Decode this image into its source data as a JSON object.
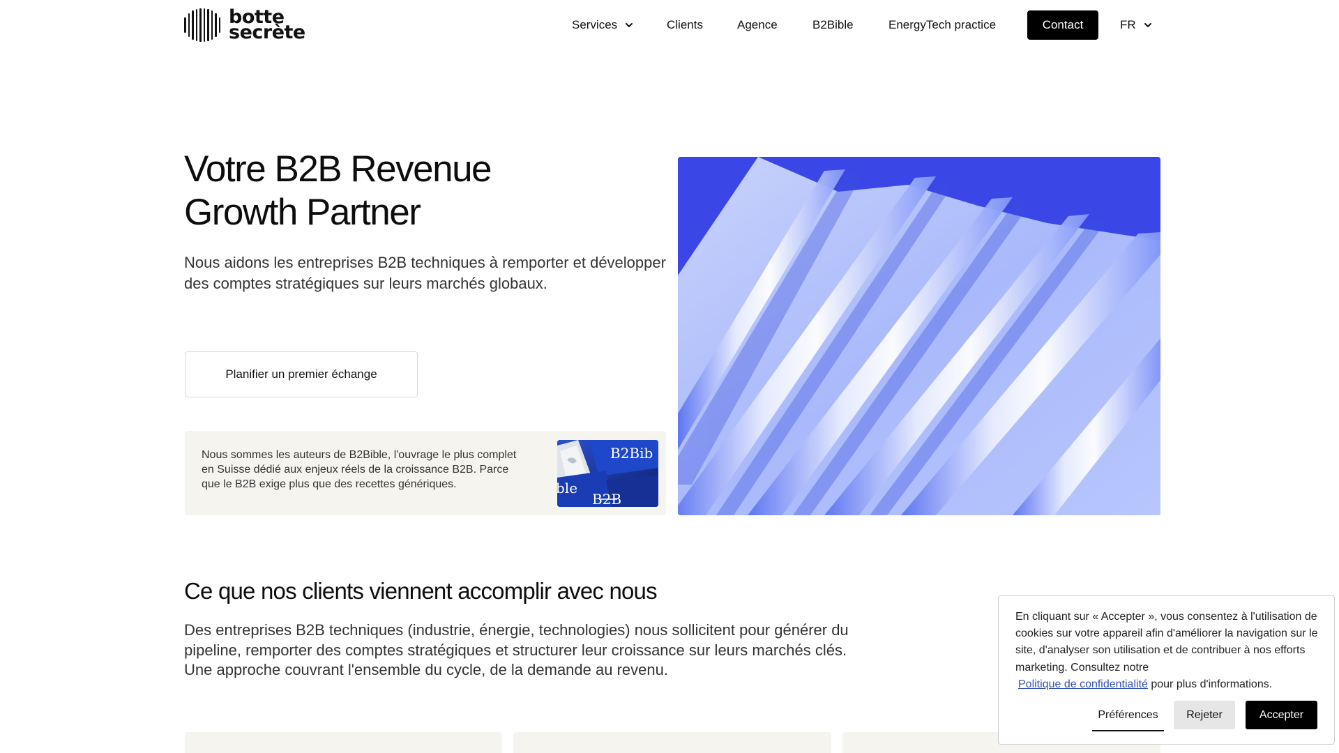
{
  "header": {
    "logo_line1": "botte",
    "logo_line2": "secrète",
    "nav": {
      "services": "Services",
      "clients": "Clients",
      "agence": "Agence",
      "b2bible": "B2Bible",
      "energytech": "EnergyTech practice",
      "contact": "Contact",
      "lang": "FR"
    }
  },
  "hero": {
    "title_line1": "Votre B2B Revenue",
    "title_line2": "Growth Partner",
    "subtitle": "Nous aidons les entreprises B2B techniques à remporter et développer des comptes stratégiques sur leurs marchés globaux.",
    "cta_label": "Planifier un premier échange",
    "book_text": "Nous sommes les auteurs de B2Bible, l'ouvrage le plus complet en Suisse dédié aux enjeux réels de la croissance B2B. Parce que le B2B exige plus que des recettes génériques.",
    "book_image_text_top": "B2Bib",
    "book_image_text_left": "ble",
    "book_image_text_bottom": "B2B"
  },
  "section": {
    "title": "Ce que nos clients viennent accomplir avec nous",
    "text": "Des entreprises B2B techniques (industrie, énergie, technologies) nous sollicitent pour générer du pipeline, remporter des comptes stratégiques et structurer leur croissance sur leurs marchés clés. Une approche couvrant l'ensemble du cycle, de la demande au revenu."
  },
  "cookie": {
    "text": "En cliquant sur « Accepter », vous consentez à l'utilisation de cookies sur votre appareil afin d'améliorer la navigation sur le site, d'analyser son utilisation et de contribuer à nos efforts marketing. Consultez notre",
    "link": "Politique de confidentialité",
    "text_end": " pour plus d'informations.",
    "preferences": "Préférences",
    "reject": "Rejeter",
    "accept": "Accepter"
  },
  "colors": {
    "accent": "#000000",
    "hero_image_blue": "#3a47e6",
    "card_bg": "#f5f4ef",
    "link": "#3450b0"
  }
}
